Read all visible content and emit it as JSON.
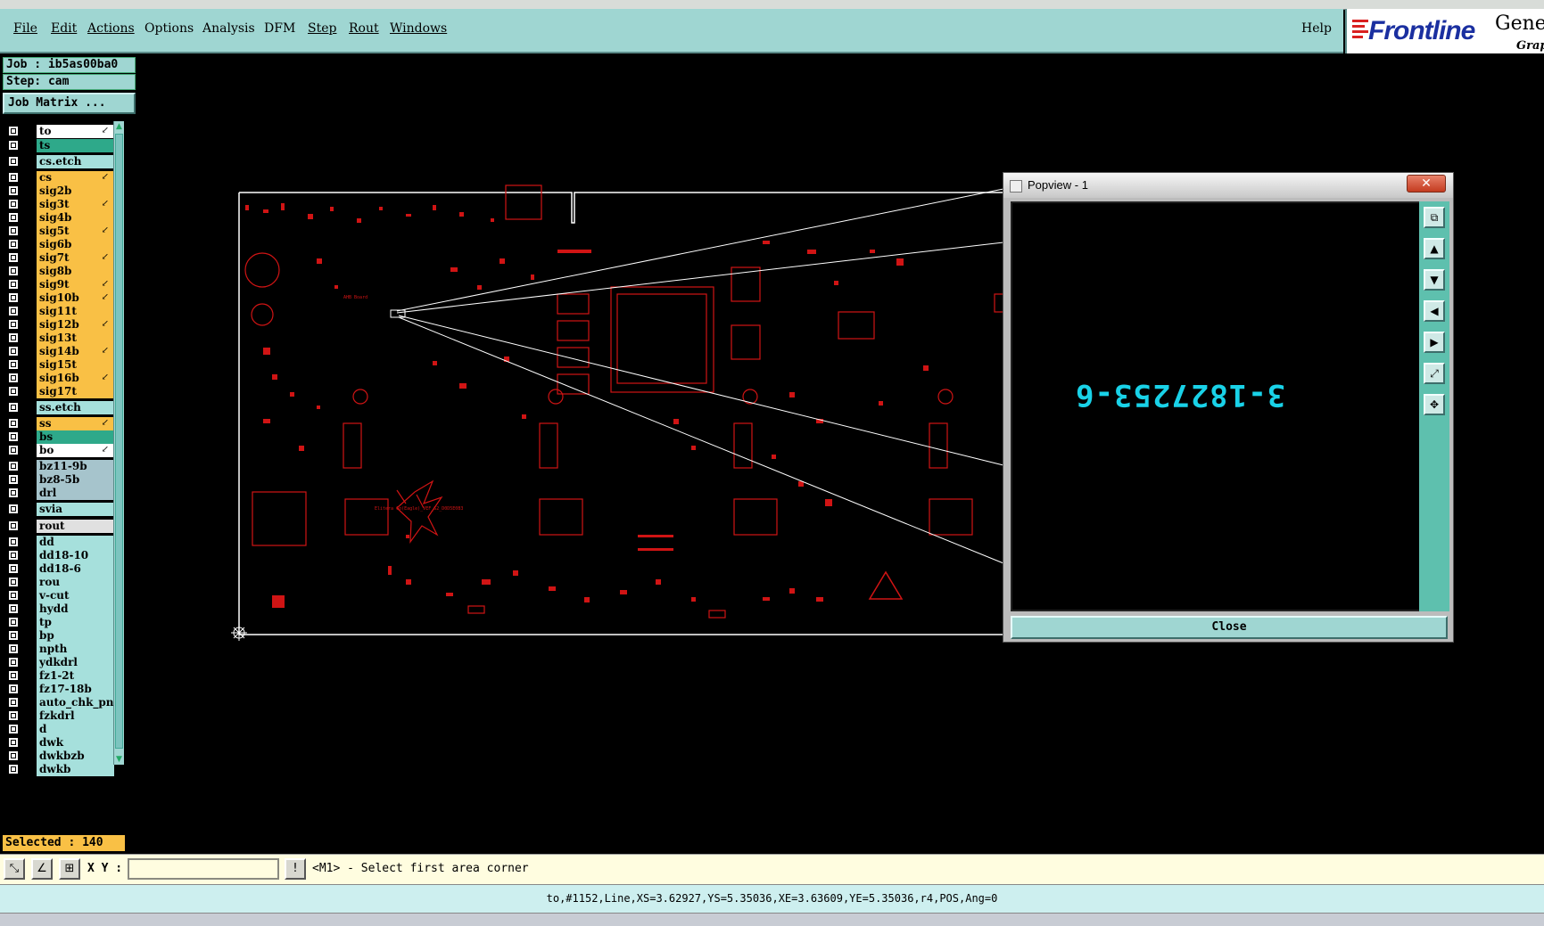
{
  "menu": {
    "items": [
      "File",
      "Edit",
      "Actions",
      "Options",
      "Analysis",
      "DFM",
      "Step",
      "Rout",
      "Windows"
    ],
    "help": "Help"
  },
  "logo": {
    "brand": "Frontline",
    "product": "Gene",
    "sub": "Grap"
  },
  "job": {
    "label": "Job : ib5as00ba0",
    "step": "Step: cam",
    "matrix_button": "Job Matrix ..."
  },
  "layers": [
    {
      "name": "to",
      "color": "#ffffff",
      "arrow": true
    },
    {
      "name": "ts",
      "color": "#2ea98a"
    },
    {
      "name": "cs.etch",
      "color": "#a6e0dc"
    },
    {
      "name": "cs",
      "color": "#f9c045",
      "arrow": true
    },
    {
      "name": "sig2b",
      "color": "#f9c045"
    },
    {
      "name": "sig3t",
      "color": "#f9c045",
      "arrow": true
    },
    {
      "name": "sig4b",
      "color": "#f9c045"
    },
    {
      "name": "sig5t",
      "color": "#f9c045",
      "arrow": true
    },
    {
      "name": "sig6b",
      "color": "#f9c045"
    },
    {
      "name": "sig7t",
      "color": "#f9c045",
      "arrow": true
    },
    {
      "name": "sig8b",
      "color": "#f9c045"
    },
    {
      "name": "sig9t",
      "color": "#f9c045",
      "arrow": true
    },
    {
      "name": "sig10b",
      "color": "#f9c045",
      "arrow": true
    },
    {
      "name": "sig11t",
      "color": "#f9c045"
    },
    {
      "name": "sig12b",
      "color": "#f9c045",
      "arrow": true
    },
    {
      "name": "sig13t",
      "color": "#f9c045"
    },
    {
      "name": "sig14b",
      "color": "#f9c045",
      "arrow": true
    },
    {
      "name": "sig15t",
      "color": "#f9c045"
    },
    {
      "name": "sig16b",
      "color": "#f9c045",
      "arrow": true
    },
    {
      "name": "sig17t",
      "color": "#f9c045"
    },
    {
      "name": "ss.etch",
      "color": "#a6e0dc"
    },
    {
      "name": "ss",
      "color": "#f9c045",
      "arrow": true
    },
    {
      "name": "bs",
      "color": "#2ea98a"
    },
    {
      "name": "bo",
      "color": "#ffffff",
      "arrow": true
    },
    {
      "name": "bz11-9b",
      "color": "#a6c4cc"
    },
    {
      "name": "bz8-5b",
      "color": "#a6c4cc"
    },
    {
      "name": "drl",
      "color": "#a6c4cc"
    },
    {
      "name": "svia",
      "color": "#a6e0dc"
    },
    {
      "name": "rout",
      "color": "#e0e0e0"
    },
    {
      "name": "dd",
      "color": "#a6e0dc"
    },
    {
      "name": "dd18-10",
      "color": "#a6e0dc"
    },
    {
      "name": "dd18-6",
      "color": "#a6e0dc"
    },
    {
      "name": "rou",
      "color": "#a6e0dc"
    },
    {
      "name": "v-cut",
      "color": "#a6e0dc"
    },
    {
      "name": "hydd",
      "color": "#a6e0dc"
    },
    {
      "name": "tp",
      "color": "#a6e0dc"
    },
    {
      "name": "bp",
      "color": "#a6e0dc"
    },
    {
      "name": "npth",
      "color": "#a6e0dc"
    },
    {
      "name": "ydkdrl",
      "color": "#a6e0dc"
    },
    {
      "name": "fz1-2t",
      "color": "#a6e0dc"
    },
    {
      "name": "fz17-18b",
      "color": "#a6e0dc"
    },
    {
      "name": "auto_chk_pnl",
      "color": "#a6e0dc"
    },
    {
      "name": "fzkdrl",
      "color": "#a6e0dc"
    },
    {
      "name": "d",
      "color": "#a6e0dc"
    },
    {
      "name": "dwk",
      "color": "#a6e0dc"
    },
    {
      "name": "dwkbzb",
      "color": "#a6e0dc"
    },
    {
      "name": "dwkb",
      "color": "#a6e0dc"
    }
  ],
  "selected": "Selected : 140",
  "popview": {
    "title": "Popview - 1",
    "close_x": "✕",
    "text": "3-1827253-6",
    "close_button": "Close",
    "tools": [
      "restore-icon",
      "arrow-up-icon",
      "arrow-down-icon",
      "arrow-left-icon",
      "arrow-right-icon",
      "zoom-fit-icon",
      "zoom-home-icon"
    ]
  },
  "board": {
    "label_center": "Elitera Go(Eagle)_VEF_S2_D0D5E0B3",
    "label_ahb": "AHB Board"
  },
  "command": {
    "xy_label": "X Y :",
    "xy_value": "",
    "prompt": "<M1> - Select first area corner"
  },
  "status": "to,#1152,Line,XS=3.62927,YS=5.35036,XE=3.63609,YE=5.35036,r4,POS,Ang=0",
  "colors": {
    "panel": "#9fd6d2",
    "pcb": "#d01414",
    "popview_text": "#19d2e8",
    "selected": "#f9c045"
  }
}
